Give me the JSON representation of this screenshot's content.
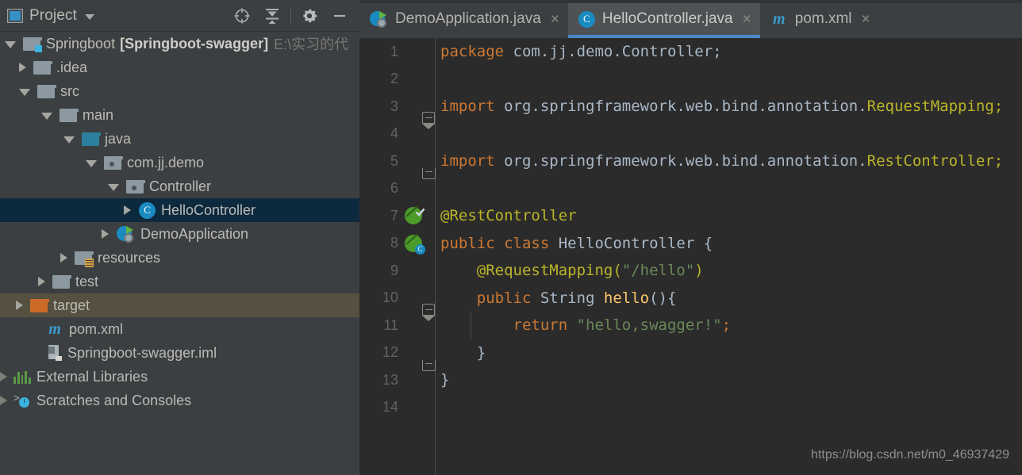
{
  "project_panel": {
    "header": {
      "title": "Project",
      "caret_icon": "chevron-down-icon",
      "window_icon": "project-window-icon",
      "buttons": [
        {
          "name": "locate-icon",
          "tooltip": "Select Opened File"
        },
        {
          "name": "collapse-all-icon",
          "tooltip": "Collapse All"
        },
        {
          "name": "gear-icon",
          "tooltip": "Settings"
        },
        {
          "name": "minimize-icon",
          "tooltip": "Hide"
        }
      ]
    },
    "tree": [
      {
        "label": "Springboot",
        "bold_label": "[Springboot-swagger]",
        "path_label": "E:\\实习的代",
        "icon": "module-folder-icon",
        "indent": 0,
        "expanded": true,
        "state": "normal"
      },
      {
        "label": ".idea",
        "icon": "folder-gray-icon",
        "indent": 1,
        "expanded": false,
        "state": "normal"
      },
      {
        "label": "src",
        "icon": "folder-gray-icon",
        "indent": 1,
        "expanded": true,
        "state": "normal"
      },
      {
        "label": "main",
        "icon": "folder-gray-icon",
        "indent": 2,
        "expanded": true,
        "state": "normal"
      },
      {
        "label": "java",
        "icon": "folder-blue-source-icon",
        "indent": 3,
        "expanded": true,
        "state": "normal"
      },
      {
        "label": "com.jj.demo",
        "icon": "package-icon",
        "indent": 4,
        "expanded": true,
        "state": "normal"
      },
      {
        "label": "Controller",
        "icon": "package-icon",
        "indent": 5,
        "expanded": true,
        "state": "normal"
      },
      {
        "label": "HelloController",
        "icon": "java-class-icon",
        "indent": 6,
        "expanded": false,
        "state": "selected"
      },
      {
        "label": "DemoApplication",
        "icon": "spring-boot-app-icon",
        "indent": 5,
        "expanded": false,
        "state": "normal"
      },
      {
        "label": "resources",
        "icon": "folder-resources-icon",
        "indent": 3,
        "expanded": false,
        "state": "normal"
      },
      {
        "label": "test",
        "icon": "folder-gray-icon",
        "indent": 2,
        "expanded": false,
        "state": "normal"
      },
      {
        "label": "target",
        "icon": "folder-orange-excluded-icon",
        "indent": 1,
        "expanded": false,
        "state": "excluded"
      },
      {
        "label": "pom.xml",
        "icon": "maven-xml-icon",
        "indent": 2,
        "expanded": null,
        "state": "normal"
      },
      {
        "label": "Springboot-swagger.iml",
        "icon": "iml-module-icon",
        "indent": 2,
        "expanded": null,
        "state": "normal"
      },
      {
        "label": "External Libraries",
        "icon": "external-libraries-icon",
        "indent": 0,
        "expanded": false,
        "state": "normal"
      },
      {
        "label": "Scratches and Consoles",
        "icon": "scratches-icon",
        "indent": 0,
        "expanded": false,
        "state": "normal"
      }
    ]
  },
  "editor": {
    "tabs": [
      {
        "label": "DemoApplication.java",
        "icon": "spring-boot-app-icon",
        "active": false,
        "close_glyph": "×"
      },
      {
        "label": "HelloController.java",
        "icon": "java-class-icon",
        "active": true,
        "close_glyph": "×"
      },
      {
        "label": "pom.xml",
        "icon": "maven-xml-icon",
        "active": false,
        "close_glyph": "×"
      }
    ],
    "lines": [
      {
        "num": "1",
        "gutter": "",
        "fold": "",
        "tokens": [
          {
            "t": "package ",
            "c": "kw"
          },
          {
            "t": "com.jj.demo.Controller;",
            "c": "pl"
          }
        ]
      },
      {
        "num": "2",
        "gutter": "",
        "fold": "",
        "tokens": []
      },
      {
        "num": "3",
        "gutter": "",
        "fold": "fold-top",
        "tokens": [
          {
            "t": "import ",
            "c": "kw"
          },
          {
            "t": "org.springframework.web.bind.annotation.",
            "c": "pl"
          },
          {
            "t": "RequestMapping;",
            "c": "an"
          }
        ]
      },
      {
        "num": "4",
        "gutter": "",
        "fold": "",
        "tokens": []
      },
      {
        "num": "5",
        "gutter": "",
        "fold": "fold-bottom",
        "tokens": [
          {
            "t": "import ",
            "c": "kw"
          },
          {
            "t": "org.springframework.web.bind.annotation.",
            "c": "pl"
          },
          {
            "t": "RestController;",
            "c": "an"
          }
        ]
      },
      {
        "num": "6",
        "gutter": "",
        "fold": "",
        "tokens": []
      },
      {
        "num": "7",
        "gutter": "spring-bean-check-icon",
        "fold": "",
        "tokens": [
          {
            "t": "@RestController",
            "c": "an"
          }
        ]
      },
      {
        "num": "8",
        "gutter": "spring-bean-class-icon",
        "fold": "",
        "tokens": [
          {
            "t": "public ",
            "c": "kw"
          },
          {
            "t": "class ",
            "c": "kw"
          },
          {
            "t": "HelloController {",
            "c": "pl"
          }
        ]
      },
      {
        "num": "9",
        "gutter": "",
        "fold": "",
        "tokens": [
          {
            "t": "    @RequestMapping(",
            "c": "an"
          },
          {
            "t": "\"/hello\"",
            "c": "str"
          },
          {
            "t": ")",
            "c": "an"
          }
        ]
      },
      {
        "num": "10",
        "gutter": "",
        "fold": "fold-method-top",
        "tokens": [
          {
            "t": "    public ",
            "c": "kw"
          },
          {
            "t": "String ",
            "c": "pl"
          },
          {
            "t": "hello",
            "c": "mth"
          },
          {
            "t": "(){",
            "c": "pl"
          }
        ]
      },
      {
        "num": "11",
        "gutter": "",
        "fold": "",
        "tokens": [
          {
            "t": "        return ",
            "c": "kw"
          },
          {
            "t": "\"hello,swagger!\"",
            "c": "str"
          },
          {
            "t": ";",
            "c": "kw"
          }
        ]
      },
      {
        "num": "12",
        "gutter": "",
        "fold": "fold-method-bottom",
        "tokens": [
          {
            "t": "    }",
            "c": "pl"
          }
        ]
      },
      {
        "num": "13",
        "gutter": "",
        "fold": "",
        "tokens": [
          {
            "t": "}",
            "c": "pl"
          }
        ]
      },
      {
        "num": "14",
        "gutter": "",
        "fold": "",
        "tokens": []
      }
    ]
  },
  "watermark": "https://blog.csdn.net/m0_46937429",
  "colors": {
    "panel_bg": "#3c3f41",
    "editor_bg": "#2b2b2b",
    "tab_active_bg": "#4e5254",
    "tab_underline": "#4a88c7",
    "tree_selection": "#0d293e",
    "tree_excluded": "#55503f",
    "keyword": "#cc7832",
    "annotation": "#bbb529",
    "string": "#6a8759",
    "method": "#ffc66d",
    "plain": "#a9b7c6",
    "line_number": "#606366"
  }
}
